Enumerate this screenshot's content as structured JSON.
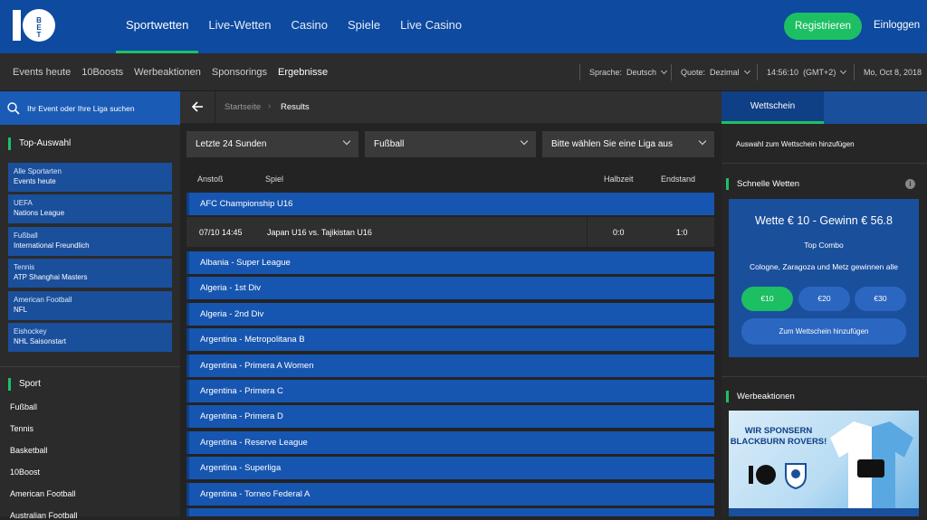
{
  "header": {
    "nav": [
      "Sportwetten",
      "Live-Wetten",
      "Casino",
      "Spiele",
      "Live Casino"
    ],
    "active_nav": "Sportwetten",
    "register_label": "Registrieren",
    "login_label": "Einloggen",
    "brand_color": "#0d4aa0",
    "accent_color": "#1dbf63"
  },
  "subnav": {
    "items": [
      "Events heute",
      "10Boosts",
      "Werbeaktionen",
      "Sponsorings",
      "Ergebnisse"
    ],
    "active": "Ergebnisse",
    "language_label": "Sprache:",
    "language_value": "Deutsch",
    "odds_label": "Quote:",
    "odds_value": "Dezimal",
    "time": "14:56:10",
    "timezone": "(GMT+2)",
    "date": "Mo, Oct 8, 2018"
  },
  "sidebar": {
    "search_placeholder": "Ihr Event oder Ihre Liga suchen",
    "top_title": "Top-Auswahl",
    "top_items": [
      {
        "line1": "Alle Sportarten",
        "line2": "Events heute"
      },
      {
        "line1": "UEFA",
        "line2": "Nations League"
      },
      {
        "line1": "Fußball",
        "line2": "International Freundlich"
      },
      {
        "line1": "Tennis",
        "line2": "ATP Shanghai Masters"
      },
      {
        "line1": "American Football",
        "line2": "NFL"
      },
      {
        "line1": "Eishockey",
        "line2": "NHL Saisonstart"
      }
    ],
    "sport_title": "Sport",
    "sports": [
      "Fußball",
      "Tennis",
      "Basketball",
      "10Boost",
      "American Football",
      "Australian Football"
    ]
  },
  "main": {
    "breadcrumb_home": "Startseite",
    "breadcrumb_sep": "›",
    "breadcrumb_current": "Results",
    "filters": [
      "Letzte 24 Sunden",
      "Fußball",
      "Bitte wählen Sie eine Liga aus"
    ],
    "columns": {
      "kickoff": "Anstoß",
      "game": "Spiel",
      "half": "Halbzeit",
      "final": "Endstand"
    },
    "expanded_league": "AFC Championship U16",
    "match": {
      "time": "07/10 14:45",
      "teams": "Japan U16 vs. Tajikistan U16",
      "half": "0:0",
      "final": "1:0"
    },
    "leagues": [
      "Albania - Super League",
      "Algeria - 1st Div",
      "Algeria - 2nd Div",
      "Argentina - Metropolitana B",
      "Argentina - Primera A Women",
      "Argentina - Primera C",
      "Argentina - Primera D",
      "Argentina - Reserve League",
      "Argentina - Superliga",
      "Argentina - Torneo Federal A"
    ]
  },
  "betslip": {
    "tab": "Wettschein",
    "empty_note": "Auswahl zum Wettschein hinzufügen",
    "quick_title": "Schnelle Wetten",
    "quick_headline": "Wette € 10 - Gewinn € 56.8",
    "quick_sub": "Top Combo",
    "quick_desc": "Cologne, Zaragoza und Metz gewinnen alle",
    "stakes": [
      "€10",
      "€20",
      "€30"
    ],
    "add_button": "Zum Wettschein hinzufügen",
    "promo_title": "Werbeaktionen",
    "promo_text": "WIR SPONSERN BLACKBURN ROVERS!"
  }
}
